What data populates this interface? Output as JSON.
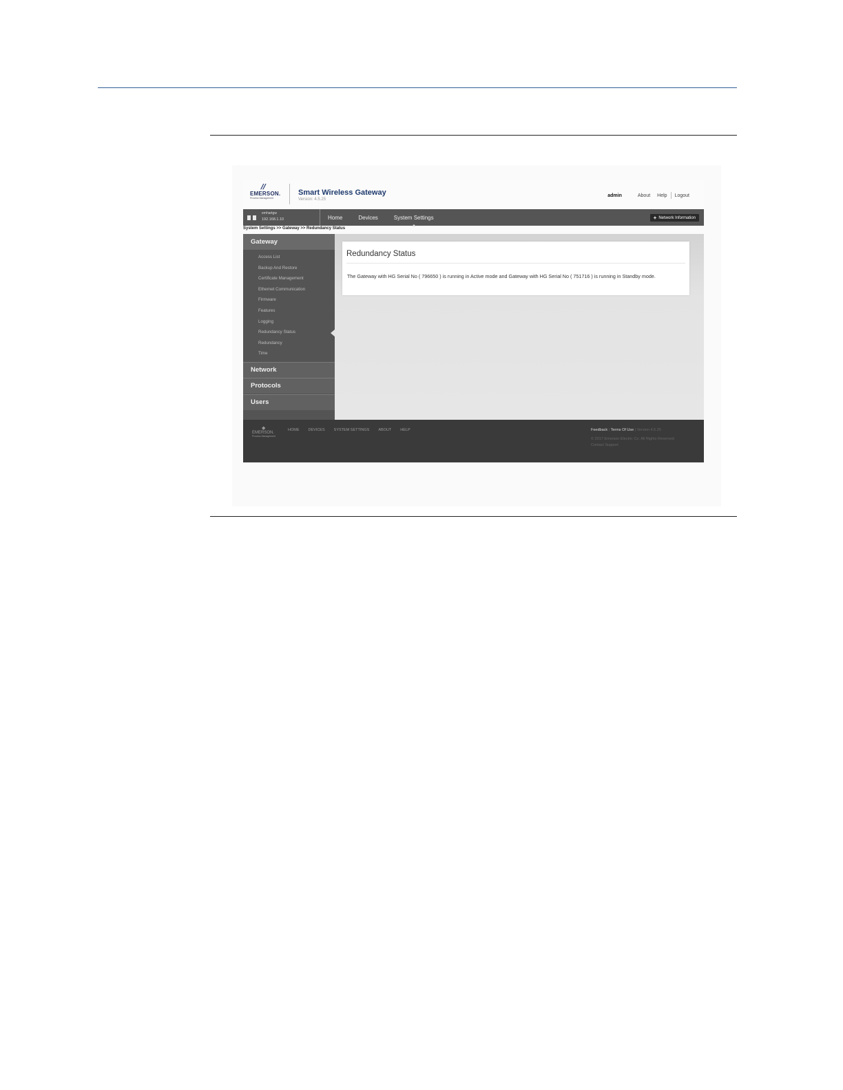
{
  "header": {
    "logo_text": "EMERSON.",
    "logo_sub": "Process Management",
    "title": "Smart Wireless Gateway",
    "version": "Version: 4.5.25",
    "user": "admin",
    "links": [
      "About",
      "Help",
      "Logout"
    ]
  },
  "nav": {
    "device_name": "emhartgw",
    "device_ip": "192.168.1.10",
    "items": [
      "Home",
      "Devices",
      "System Settings"
    ],
    "active": "System Settings",
    "network_button": "Network Information"
  },
  "breadcrumb": "System Settings >> Gateway >> Redundancy Status",
  "sidebar": {
    "section": "Gateway",
    "items": [
      "Access List",
      "Backup And Restore",
      "Certificate Management",
      "Ethernet Communication",
      "Firmware",
      "Features",
      "Logging",
      "Redundancy Status",
      "Redundancy",
      "Time"
    ],
    "selected": "Redundancy Status",
    "other_sections": [
      "Network",
      "Protocols",
      "Users"
    ]
  },
  "content": {
    "title": "Redundancy Status",
    "message": "The Gateway with HG Serial No ( 796650 ) is running in Active mode and Gateway with HG Serial No ( 751716 ) is running in Standby mode."
  },
  "footer": {
    "logo_text": "EMERSON.",
    "logo_sub": "Process Management",
    "nav": [
      "HOME",
      "DEVICES",
      "SYSTEM SETTINGS",
      "ABOUT",
      "HELP"
    ],
    "feedback": "Feedback",
    "terms": "Terms Of Use",
    "version": "Version 4.5.25",
    "copyright": "© 2017 Emerson Electric Co. All Rights Reserved.",
    "support": "Contact Support"
  }
}
